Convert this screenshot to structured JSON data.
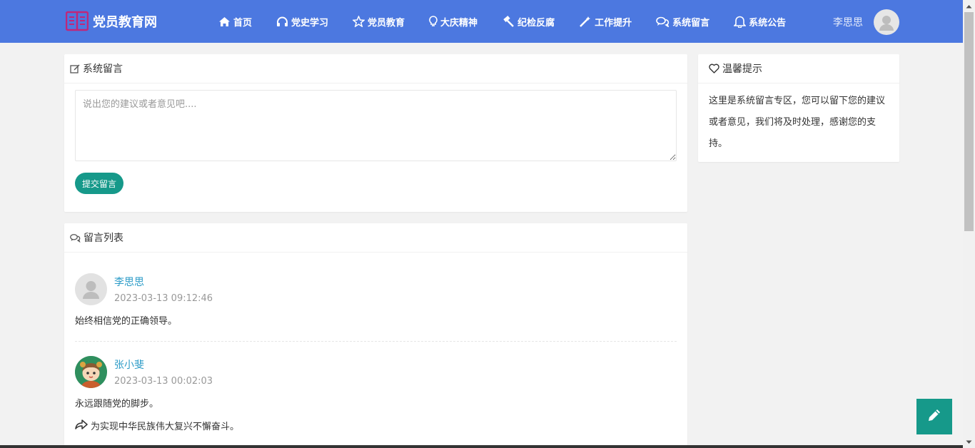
{
  "header": {
    "brand": "党员教育网",
    "nav": [
      {
        "label": "首页",
        "icon": "home-icon"
      },
      {
        "label": "党史学习",
        "icon": "headphones-icon"
      },
      {
        "label": "党员教育",
        "icon": "star-icon"
      },
      {
        "label": "大庆精神",
        "icon": "lightbulb-icon"
      },
      {
        "label": "纪检反腐",
        "icon": "gavel-icon"
      },
      {
        "label": "工作提升",
        "icon": "magic-wand-icon"
      },
      {
        "label": "系统留言",
        "icon": "comments-icon"
      },
      {
        "label": "系统公告",
        "icon": "bell-icon"
      }
    ],
    "user_name": "李思思"
  },
  "message_form": {
    "title": "系统留言",
    "placeholder": "说出您的建议或者意见吧....",
    "submit_label": "提交留言"
  },
  "message_list": {
    "title": "留言列表",
    "items": [
      {
        "name": "李思思",
        "time": "2023-03-13 09:12:46",
        "content": "始终相信党的正确领导。"
      },
      {
        "name": "张小斐",
        "time": "2023-03-13 00:02:03",
        "content": "永远跟随党的脚步。",
        "reply": "为实现中华民族伟大复兴不懈奋斗。"
      }
    ]
  },
  "tips": {
    "title": "温馨提示",
    "text": "这里是系统留言专区，您可以留下您的建议或者意见，我们将及时处理，感谢您的支持。"
  },
  "colors": {
    "header_bg": "#4c78e0",
    "accent": "#16998a",
    "link": "#2b9bc7",
    "brand_icon": "#c0267a"
  }
}
